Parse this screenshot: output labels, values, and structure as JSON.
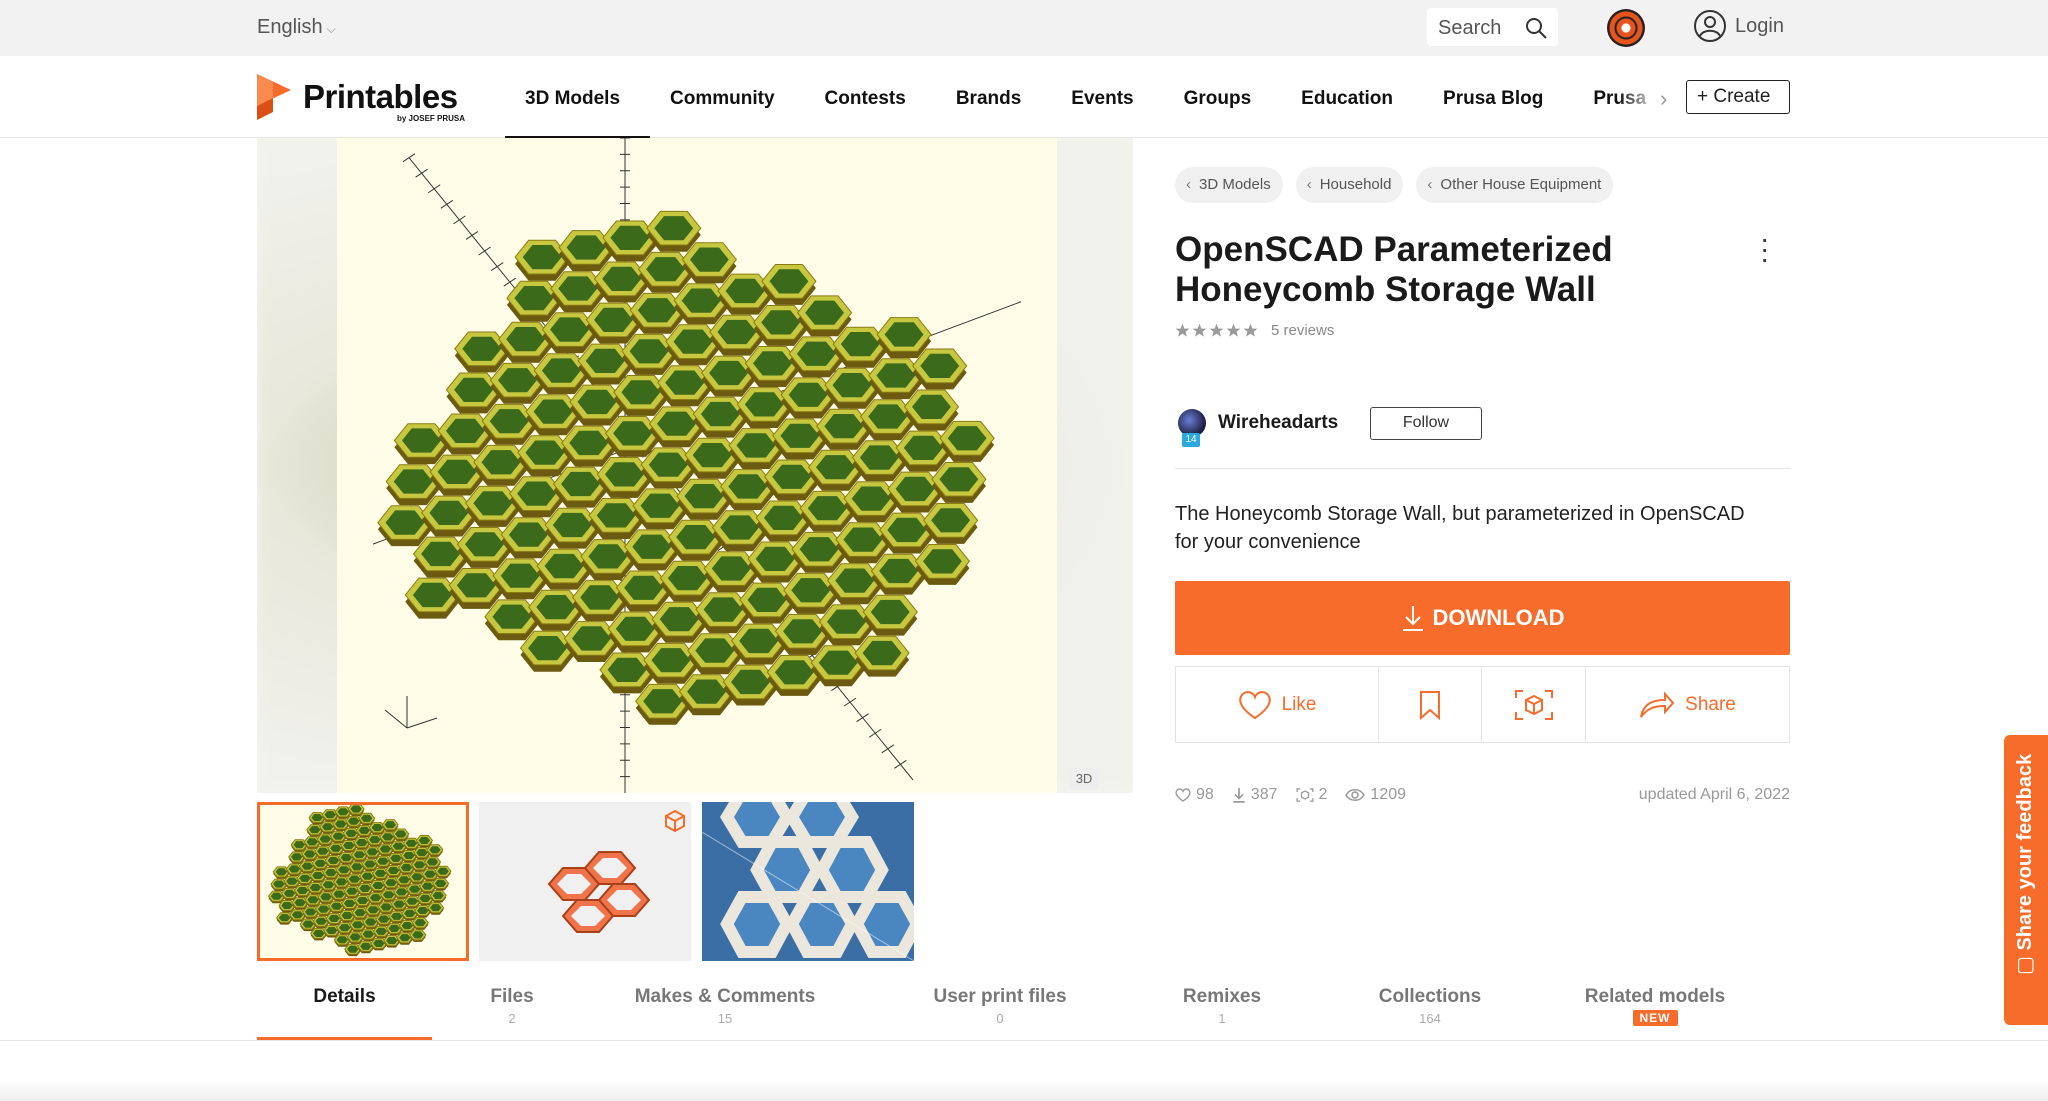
{
  "topbar": {
    "language": "English",
    "search_label": "Search",
    "login_label": "Login"
  },
  "nav": {
    "brand": "Printables",
    "brand_sub": "by JOSEF PRUSA",
    "items": [
      "3D Models",
      "Community",
      "Contests",
      "Brands",
      "Events",
      "Groups",
      "Education",
      "Prusa Blog",
      "Prusa"
    ],
    "create_label": "+ Create"
  },
  "gallery": {
    "badge_3d": "3D"
  },
  "breadcrumbs": [
    "3D Models",
    "Household",
    "Other House Equipment"
  ],
  "model": {
    "title": "OpenSCAD Parameterized Honeycomb Storage Wall",
    "rating": 5,
    "reviews": "5 reviews",
    "author": "Wireheadarts",
    "author_level": "14",
    "follow_label": "Follow",
    "description": "The Honeycomb Storage Wall, but parameterized in OpenSCAD for your convenience",
    "download_label": "DOWNLOAD",
    "like_label": "Like",
    "share_label": "Share"
  },
  "stats": {
    "likes": "98",
    "downloads": "387",
    "makes": "2",
    "views": "1209",
    "updated": "updated April 6, 2022"
  },
  "tabs": [
    {
      "label": "Details",
      "count": ""
    },
    {
      "label": "Files",
      "count": "2"
    },
    {
      "label": "Makes & Comments",
      "count": "15"
    },
    {
      "label": "User print files",
      "count": "0"
    },
    {
      "label": "Remixes",
      "count": "1"
    },
    {
      "label": "Collections",
      "count": "164"
    },
    {
      "label": "Related models",
      "count": "",
      "badge": "NEW"
    }
  ],
  "feedback_label": "Share your feedback",
  "colors": {
    "accent": "#f76b2b",
    "honeycomb_fill": "#c8c840",
    "honeycomb_edge": "#3a6a1a"
  }
}
